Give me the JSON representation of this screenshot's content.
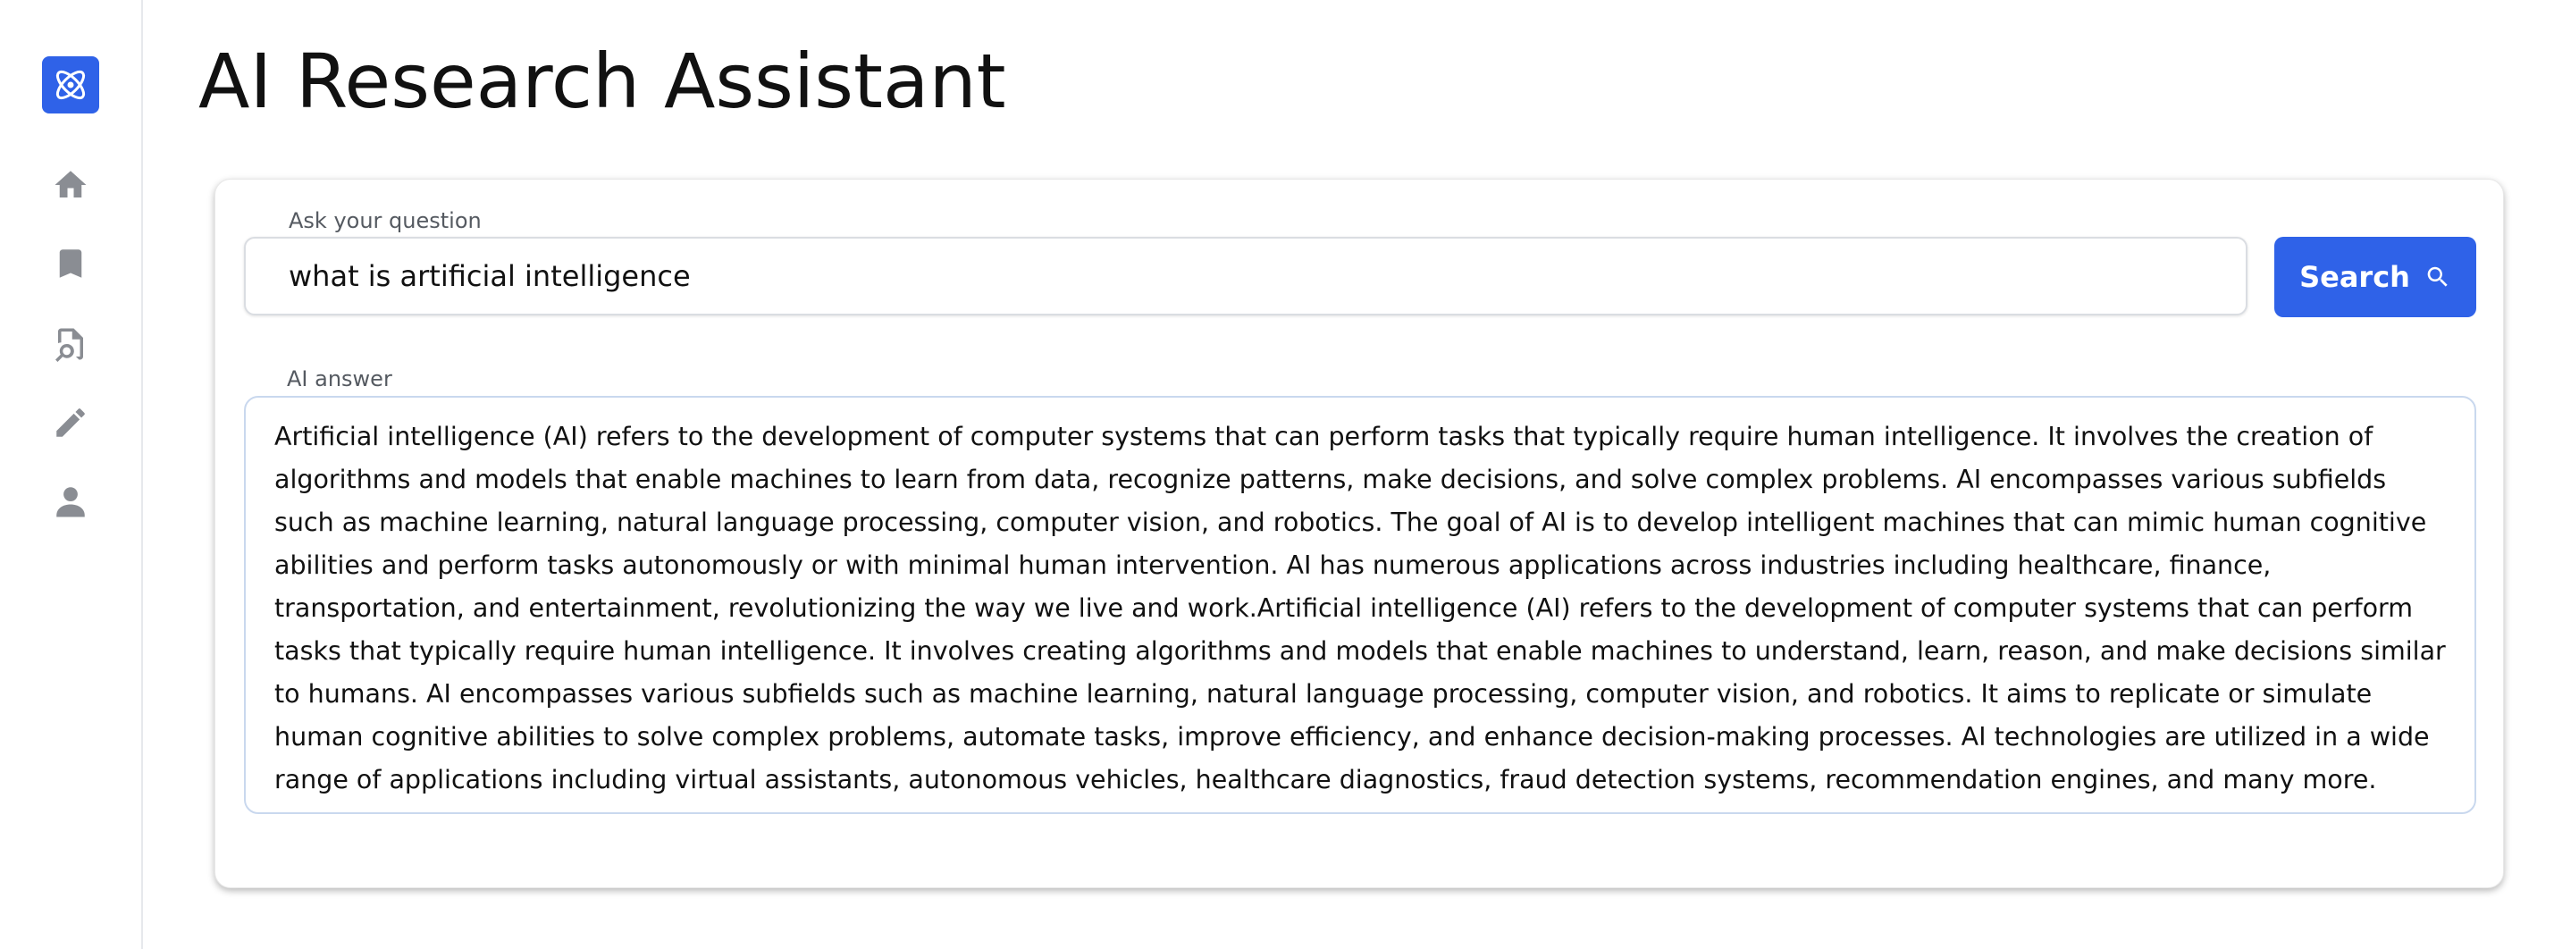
{
  "app": {
    "title": "AI Research Assistant"
  },
  "sidebar": {
    "logo_icon": "atom-icon",
    "items": [
      {
        "icon": "home-icon"
      },
      {
        "icon": "bookmark-icon"
      },
      {
        "icon": "document-search-icon"
      },
      {
        "icon": "pencil-icon"
      },
      {
        "icon": "user-icon"
      }
    ]
  },
  "search": {
    "label": "Ask your question",
    "value": "what is artificial intelligence",
    "button_label": "Search",
    "button_icon": "search-icon"
  },
  "answer": {
    "label": "AI answer",
    "text": "Artificial intelligence (AI) refers to the development of computer systems that can perform tasks that typically require human intelligence. It involves the creation of algorithms and models that enable machines to learn from data, recognize patterns, make decisions, and solve complex problems. AI encompasses various subfields such as machine learning, natural language processing, computer vision, and robotics. The goal of AI is to develop intelligent machines that can mimic human cognitive abilities and perform tasks autonomously or with minimal human intervention. AI has numerous applications across industries including healthcare, finance, transportation, and entertainment, revolutionizing the way we live and work.Artificial intelligence (AI) refers to the development of computer systems that can perform tasks that typically require human intelligence. It involves creating algorithms and models that enable machines to understand, learn, reason, and make decisions similar to humans. AI encompasses various subfields such as machine learning, natural language processing, computer vision, and robotics. It aims to replicate or simulate human cognitive abilities to solve complex problems, automate tasks, improve efficiency, and enhance decision-making processes. AI technologies are utilized in a wide range of applications including virtual assistants, autonomous vehicles, healthcare diagnostics, fraud detection systems, recommendation engines, and many more."
  },
  "colors": {
    "accent": "#2f62e8",
    "sidebar_icon": "#8a8d93",
    "answer_border": "#c9d8ee"
  }
}
